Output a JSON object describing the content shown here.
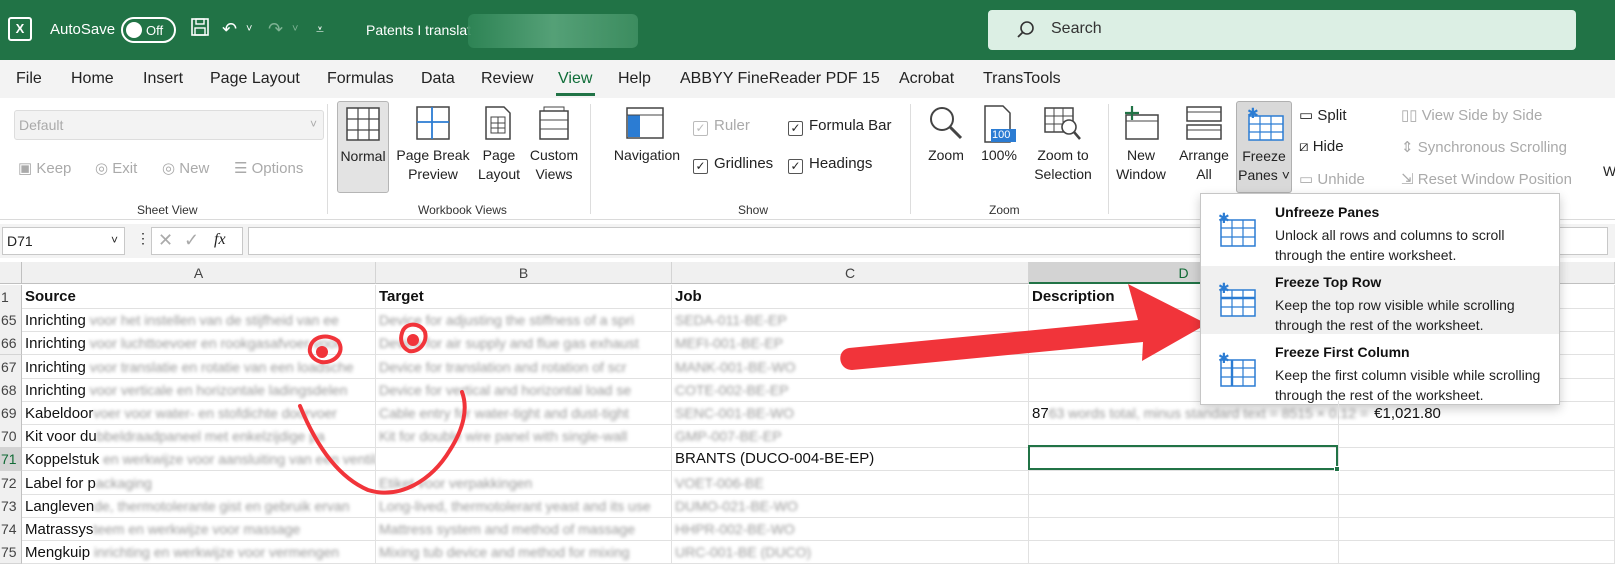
{
  "titlebar": {
    "autosave": "AutoSave",
    "toggle": "Off",
    "doc_title": "Patents I translat",
    "search": "Search"
  },
  "menu": [
    "File",
    "Home",
    "Insert",
    "Page Layout",
    "Formulas",
    "Data",
    "Review",
    "View",
    "Help",
    "ABBYY FineReader PDF 15",
    "Acrobat",
    "TransTools"
  ],
  "ribbon": {
    "sheet_view": {
      "dropdown": "Default",
      "keep": "Keep",
      "exit": "Exit",
      "new": "New",
      "options": "Options",
      "label": "Sheet View"
    },
    "workbook_views": {
      "normal": "Normal",
      "page_break_1": "Page Break",
      "page_break_2": "Preview",
      "page_layout_1": "Page",
      "page_layout_2": "Layout",
      "custom_1": "Custom",
      "custom_2": "Views",
      "label": "Workbook Views"
    },
    "show": {
      "navigation": "Navigation",
      "ruler": "Ruler",
      "formula_bar": "Formula Bar",
      "gridlines": "Gridlines",
      "headings": "Headings",
      "label": "Show"
    },
    "zoom": {
      "zoom": "Zoom",
      "zoom100": "100%",
      "zoom100_badge": "100",
      "zoom_sel_1": "Zoom to",
      "zoom_sel_2": "Selection",
      "label": "Zoom"
    },
    "window": {
      "new_1": "New",
      "new_2": "Window",
      "arrange_1": "Arrange",
      "arrange_2": "All",
      "freeze_1": "Freeze",
      "freeze_2": "Panes ˅",
      "split": "Split",
      "hide": "Hide",
      "unhide": "Unhide",
      "side": "View Side by Side",
      "sync": "Synchronous Scrolling",
      "reset": "Reset Window Position",
      "cut_w": "W"
    }
  },
  "formula": {
    "namebox": "D71",
    "fx": "fx"
  },
  "columns": [
    "A",
    "B",
    "C",
    "D"
  ],
  "header_row": {
    "num": "1",
    "a": "Source",
    "b": "Target",
    "c": "Job",
    "d": "Description"
  },
  "rows": [
    {
      "num": "65",
      "a": "Inrichting",
      "a_blur": " voor het instellen van de stijfheid van ee",
      "b": "Device for adjusting the stiffness of a spri",
      "c": "SEDA-011-BE-EP",
      "d": ""
    },
    {
      "num": "66",
      "a": "Inrichting",
      "a_blur": " voor luchttoevoer en rookgasafvoer voor",
      "b": "Device for air supply and flue gas exhaust",
      "c": "MEFI-001-BE-EP",
      "d": ""
    },
    {
      "num": "67",
      "a": "Inrichting",
      "a_blur": " voor translatie en rotatie van een loadsche",
      "b": "Device for translation and rotation of scr",
      "c": "MANK-001-BE-WO",
      "d": ""
    },
    {
      "num": "68",
      "a": "Inrichting",
      "a_blur": " voor verticale en horizontale ladingsdelen",
      "b": "Device for vertical and horizontal load se",
      "c": "COTE-002-BE-EP",
      "d": ""
    },
    {
      "num": "69",
      "a": "Kabeldoor",
      "a_blur": "voer voor water- en stofdichte doorvoer",
      "b": "Cable entry for water-tight and dust-tight",
      "c": "SENC-001-BE-WO",
      "d": "87",
      "d_blur": "63 words total, minus standard text = 8515 × 0.12 =",
      "d_end": "€1,021.80"
    },
    {
      "num": "70",
      "a": "Kit voor du",
      "a_blur": "bbeldraadpaneel met enkelzijdige pa",
      "b": "Kit for double wire panel with single-wall",
      "c": "GMP-007-BE-EP",
      "d": ""
    },
    {
      "num": "71",
      "a": "Koppelstuk",
      "a_blur": " en werkwijze voor aansluiting van een ventilatietoestel op een ventilatietoestel",
      "b": "",
      "c": "BRANTS (DUCO-004-BE-EP)",
      "d": ""
    },
    {
      "num": "72",
      "a": "Label for p",
      "a_blur": "ackaging",
      "b": "Etiket voor verpakkingen",
      "c": "VOET-006-BE",
      "d": ""
    },
    {
      "num": "73",
      "a": "Langleven",
      "a_blur": "de, thermotolerante gist en gebruik ervan",
      "b": "Long-lived, thermotolerant yeast and its use",
      "c": "DUMO-021-BE-WO",
      "d": ""
    },
    {
      "num": "74",
      "a": "Matrassys",
      "a_blur": "teem en werkwijze voor massage",
      "b": "Mattress system and method of massage",
      "c": "HHPR-002-BE-WO",
      "d": ""
    },
    {
      "num": "75",
      "a": "Mengkuip",
      "a_blur": " inrichting en werkwijze voor vermengen",
      "b": "Mixing tub device and method for mixing",
      "c": "URC-001-BE (DUCO)",
      "d": ""
    }
  ],
  "freeze_menu": [
    {
      "title": "Unfreeze Panes",
      "desc": "Unlock all rows and columns to scroll through the entire worksheet."
    },
    {
      "title": "Freeze Top Row",
      "desc": "Keep the top row visible while scrolling through the rest of the worksheet."
    },
    {
      "title": "Freeze First Column",
      "desc": "Keep the first column visible while scrolling through the rest of the worksheet."
    }
  ],
  "colors": {
    "excel_green": "#217346",
    "annotation_red": "#f1343a"
  }
}
